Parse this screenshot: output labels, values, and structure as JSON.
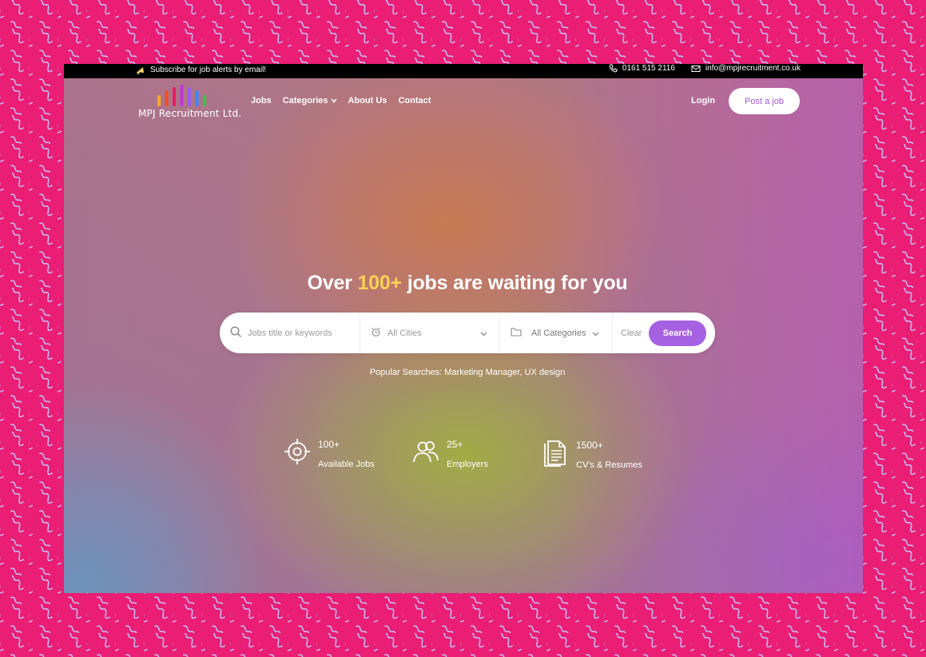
{
  "topbar": {
    "subscribe_text": "Subscribe for job alerts by email!",
    "phone": "0161 515 2116",
    "email": "info@mpjrecruitment.co.uk"
  },
  "brand": {
    "name": "MPJ Recruitment Ltd.",
    "bar_colors": [
      "#f5a623",
      "#f04e23",
      "#e91e63",
      "#c236d9",
      "#9b5de5",
      "#3a86ff",
      "#2ecc40"
    ]
  },
  "nav": {
    "items": [
      {
        "label": "Jobs"
      },
      {
        "label": "Categories"
      },
      {
        "label": "About Us"
      },
      {
        "label": "Contact"
      }
    ],
    "login": "Login",
    "post_job": "Post a job"
  },
  "hero": {
    "title_prefix": "Over ",
    "title_highlight": "100+",
    "title_suffix": " jobs are waiting for you",
    "highlight_color": "#f7d154"
  },
  "search": {
    "keyword_placeholder": "Jobs title or keywords",
    "city": "All Cities",
    "category": "All Categories",
    "clear": "Clear",
    "button": "Search",
    "accent": "#a660e2"
  },
  "popular": {
    "label": "Popular Searches:",
    "items": [
      "Marketing Manager,",
      "UX design"
    ]
  },
  "stats": [
    {
      "value": "100+",
      "label": "Available Jobs",
      "icon": "target-icon"
    },
    {
      "value": "25+",
      "label": "Employers",
      "icon": "users-icon"
    },
    {
      "value": "1500+",
      "label": "CV's & Resumes",
      "icon": "document-icon"
    }
  ]
}
